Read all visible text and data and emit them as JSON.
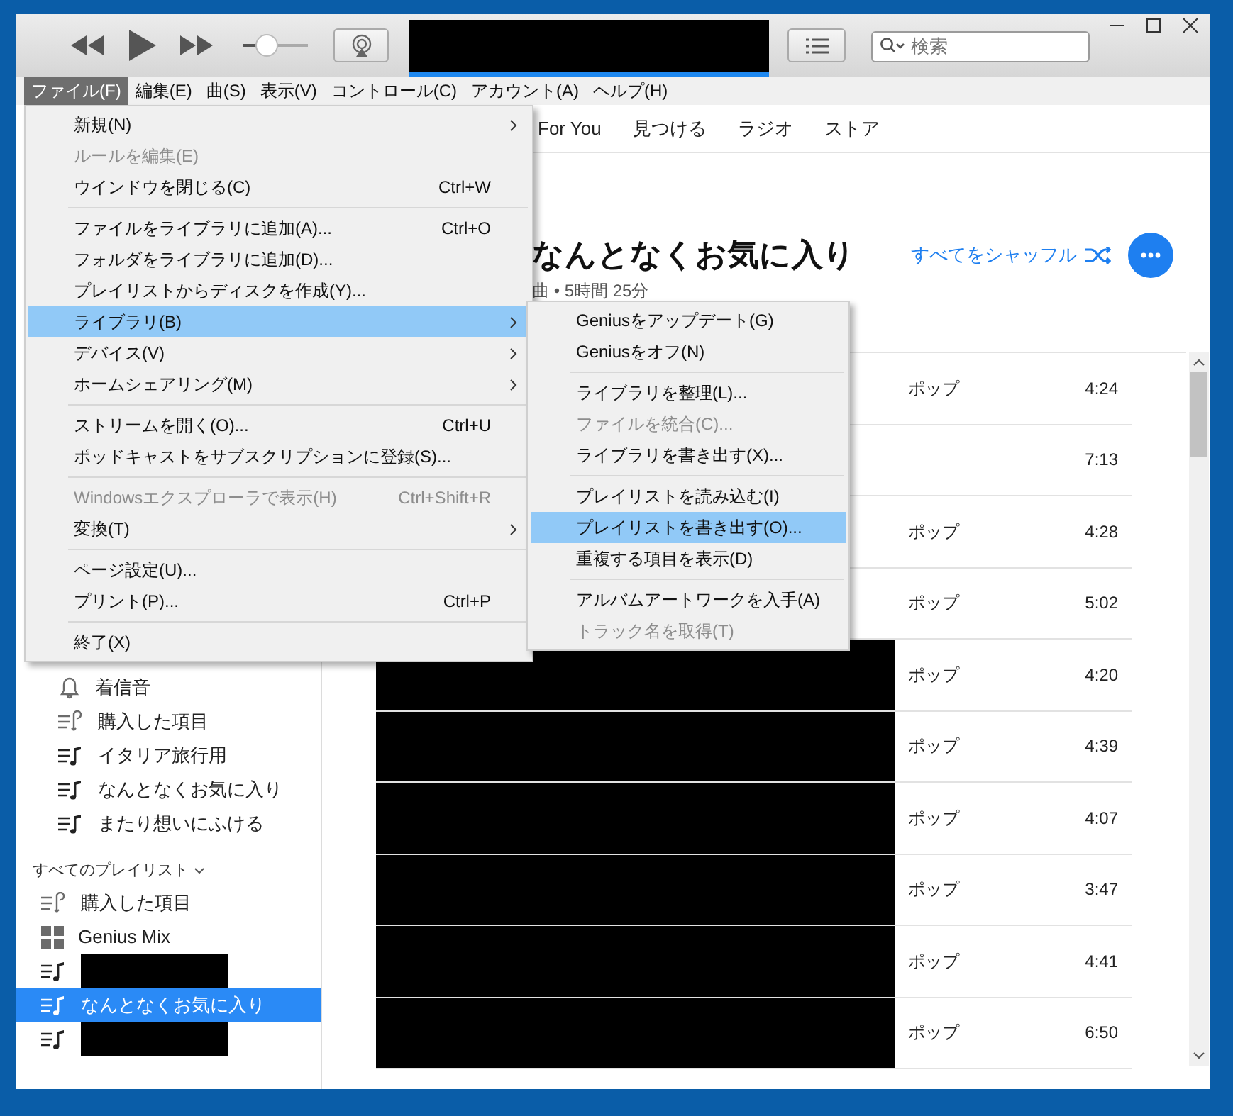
{
  "toolbar": {
    "volume": {
      "level": 0.38
    },
    "search": {
      "placeholder": "検索"
    }
  },
  "menubar": [
    {
      "label": "ファイル(F)",
      "selected": true
    },
    {
      "label": "編集(E)",
      "selected": false
    },
    {
      "label": "曲(S)",
      "selected": false
    },
    {
      "label": "表示(V)",
      "selected": false
    },
    {
      "label": "コントロール(C)",
      "selected": false
    },
    {
      "label": "アカウント(A)",
      "selected": false
    },
    {
      "label": "ヘルプ(H)",
      "selected": false
    }
  ],
  "file_menu": [
    {
      "kind": "item",
      "label": "新規(N)",
      "submenu": true,
      "disabled": false,
      "selected": false
    },
    {
      "kind": "item",
      "label": "ルールを編集(E)",
      "disabled": true,
      "selected": false
    },
    {
      "kind": "item",
      "label": "ウインドウを閉じる(C)",
      "shortcut": "Ctrl+W",
      "disabled": false,
      "selected": false
    },
    {
      "kind": "separator"
    },
    {
      "kind": "item",
      "label": "ファイルをライブラリに追加(A)...",
      "shortcut": "Ctrl+O",
      "disabled": false,
      "selected": false
    },
    {
      "kind": "item",
      "label": "フォルダをライブラリに追加(D)...",
      "disabled": false,
      "selected": false
    },
    {
      "kind": "item",
      "label": "プレイリストからディスクを作成(Y)...",
      "disabled": false,
      "selected": false
    },
    {
      "kind": "item",
      "label": "ライブラリ(B)",
      "submenu": true,
      "disabled": false,
      "selected": true
    },
    {
      "kind": "item",
      "label": "デバイス(V)",
      "submenu": true,
      "disabled": false,
      "selected": false
    },
    {
      "kind": "item",
      "label": "ホームシェアリング(M)",
      "submenu": true,
      "disabled": false,
      "selected": false
    },
    {
      "kind": "separator"
    },
    {
      "kind": "item",
      "label": "ストリームを開く(O)...",
      "shortcut": "Ctrl+U",
      "disabled": false,
      "selected": false
    },
    {
      "kind": "item",
      "label": "ポッドキャストをサブスクリプションに登録(S)...",
      "disabled": false,
      "selected": false
    },
    {
      "kind": "separator"
    },
    {
      "kind": "item",
      "label": "Windowsエクスプローラで表示(H)",
      "shortcut": "Ctrl+Shift+R",
      "disabled": true,
      "selected": false
    },
    {
      "kind": "item",
      "label": "変換(T)",
      "submenu": true,
      "disabled": false,
      "selected": false
    },
    {
      "kind": "separator"
    },
    {
      "kind": "item",
      "label": "ページ設定(U)...",
      "disabled": false,
      "selected": false
    },
    {
      "kind": "item",
      "label": "プリント(P)...",
      "shortcut": "Ctrl+P",
      "disabled": false,
      "selected": false
    },
    {
      "kind": "separator"
    },
    {
      "kind": "item",
      "label": "終了(X)",
      "disabled": false,
      "selected": false
    }
  ],
  "library_submenu": [
    {
      "kind": "item",
      "label": "Geniusをアップデート(G)",
      "disabled": false,
      "selected": false
    },
    {
      "kind": "item",
      "label": "Geniusをオフ(N)",
      "disabled": false,
      "selected": false
    },
    {
      "kind": "separator"
    },
    {
      "kind": "item",
      "label": "ライブラリを整理(L)...",
      "disabled": false,
      "selected": false
    },
    {
      "kind": "item",
      "label": "ファイルを統合(C)...",
      "disabled": true,
      "selected": false
    },
    {
      "kind": "item",
      "label": "ライブラリを書き出す(X)...",
      "disabled": false,
      "selected": false
    },
    {
      "kind": "separator"
    },
    {
      "kind": "item",
      "label": "プレイリストを読み込む(I)",
      "disabled": false,
      "selected": false
    },
    {
      "kind": "item",
      "label": "プレイリストを書き出す(O)...",
      "disabled": false,
      "selected": true
    },
    {
      "kind": "item",
      "label": "重複する項目を表示(D)",
      "disabled": false,
      "selected": false
    },
    {
      "kind": "separator"
    },
    {
      "kind": "item",
      "label": "アルバムアートワークを入手(A)",
      "disabled": false,
      "selected": false
    },
    {
      "kind": "item",
      "label": "トラック名を取得(T)",
      "disabled": true,
      "selected": false
    }
  ],
  "nav_tabs": [
    {
      "label": "For You",
      "selected": false
    },
    {
      "label": "見つける",
      "selected": false
    },
    {
      "label": "ラジオ",
      "selected": false
    },
    {
      "label": "ストア",
      "selected": false
    }
  ],
  "sidebar": {
    "items": [
      {
        "kind": "bell",
        "label": "着信音",
        "selected": false
      },
      {
        "kind": "purchased",
        "label": "購入した項目",
        "selected": false
      },
      {
        "kind": "playlist",
        "label": "イタリア旅行用",
        "selected": false
      },
      {
        "kind": "playlist",
        "label": "なんとなくお気に入り",
        "selected": false
      },
      {
        "kind": "playlist",
        "label": "またり想いにふける",
        "selected": false
      }
    ],
    "section": {
      "title": "すべてのプレイリスト",
      "items": [
        {
          "kind": "purchased",
          "label": "購入した項目",
          "selected": false
        },
        {
          "kind": "genius",
          "label": "Genius Mix",
          "selected": false
        },
        {
          "kind": "playlist",
          "redacted": true,
          "selected": false
        },
        {
          "kind": "playlist",
          "label": "なんとなくお気に入り",
          "selected": true
        },
        {
          "kind": "playlist",
          "redacted": true,
          "selected": false
        }
      ]
    }
  },
  "playlist": {
    "title": "なんとなくお気に入り",
    "subtitle": "曲 • 5時間 25分",
    "shuffle": "すべてをシャッフル"
  },
  "tracks": [
    {
      "redacted": false,
      "genre": "ポップ",
      "time": "4:24"
    },
    {
      "redacted": false,
      "time": "7:13"
    },
    {
      "redacted": false,
      "genre": "ポップ",
      "time": "4:28"
    },
    {
      "redacted": false,
      "genre": "ポップ",
      "time": "5:02"
    },
    {
      "redacted": true,
      "genre": "ポップ",
      "time": "4:20"
    },
    {
      "redacted": true,
      "genre": "ポップ",
      "time": "4:39"
    },
    {
      "redacted": true,
      "genre": "ポップ",
      "time": "4:07"
    },
    {
      "redacted": true,
      "genre": "ポップ",
      "time": "3:47"
    },
    {
      "redacted": true,
      "genre": "ポップ",
      "time": "4:41"
    },
    {
      "redacted": true,
      "genre": "ポップ",
      "time": "6:50"
    }
  ]
}
